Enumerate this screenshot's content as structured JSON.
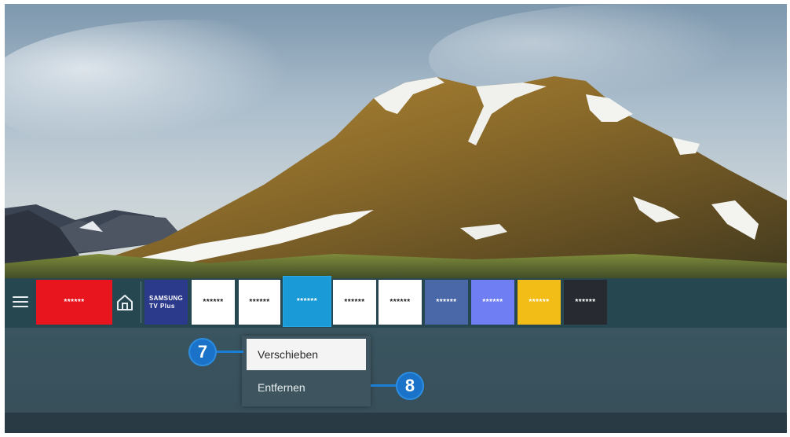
{
  "menu_icon": "hamburger-icon",
  "home_icon": "home-icon",
  "app_bar": {
    "tiles": [
      {
        "label": "******",
        "bg": "#e8141e",
        "style": "light"
      },
      {
        "label_line1": "SAMSUNG",
        "label_line2": "TV Plus",
        "bg": "#2c3a8c",
        "style": "logo"
      },
      {
        "label": "******",
        "bg": "#ffffff",
        "style": "dark"
      },
      {
        "label": "******",
        "bg": "#ffffff",
        "style": "dark"
      },
      {
        "label": "******",
        "bg": "#1a9ad6",
        "style": "light",
        "focused": true
      },
      {
        "label": "******",
        "bg": "#ffffff",
        "style": "dark"
      },
      {
        "label": "******",
        "bg": "#ffffff",
        "style": "dark"
      },
      {
        "label": "******",
        "bg": "#4a67a8",
        "style": "light"
      },
      {
        "label": "******",
        "bg": "#6f7ef2",
        "style": "light"
      },
      {
        "label": "******",
        "bg": "#f3bd17",
        "style": "light"
      },
      {
        "label": "******",
        "bg": "#272a31",
        "style": "light"
      }
    ]
  },
  "options_menu": {
    "items": [
      "Verschieben",
      "Entfernen"
    ],
    "focused_index": 0
  },
  "callouts": [
    "7",
    "8"
  ]
}
